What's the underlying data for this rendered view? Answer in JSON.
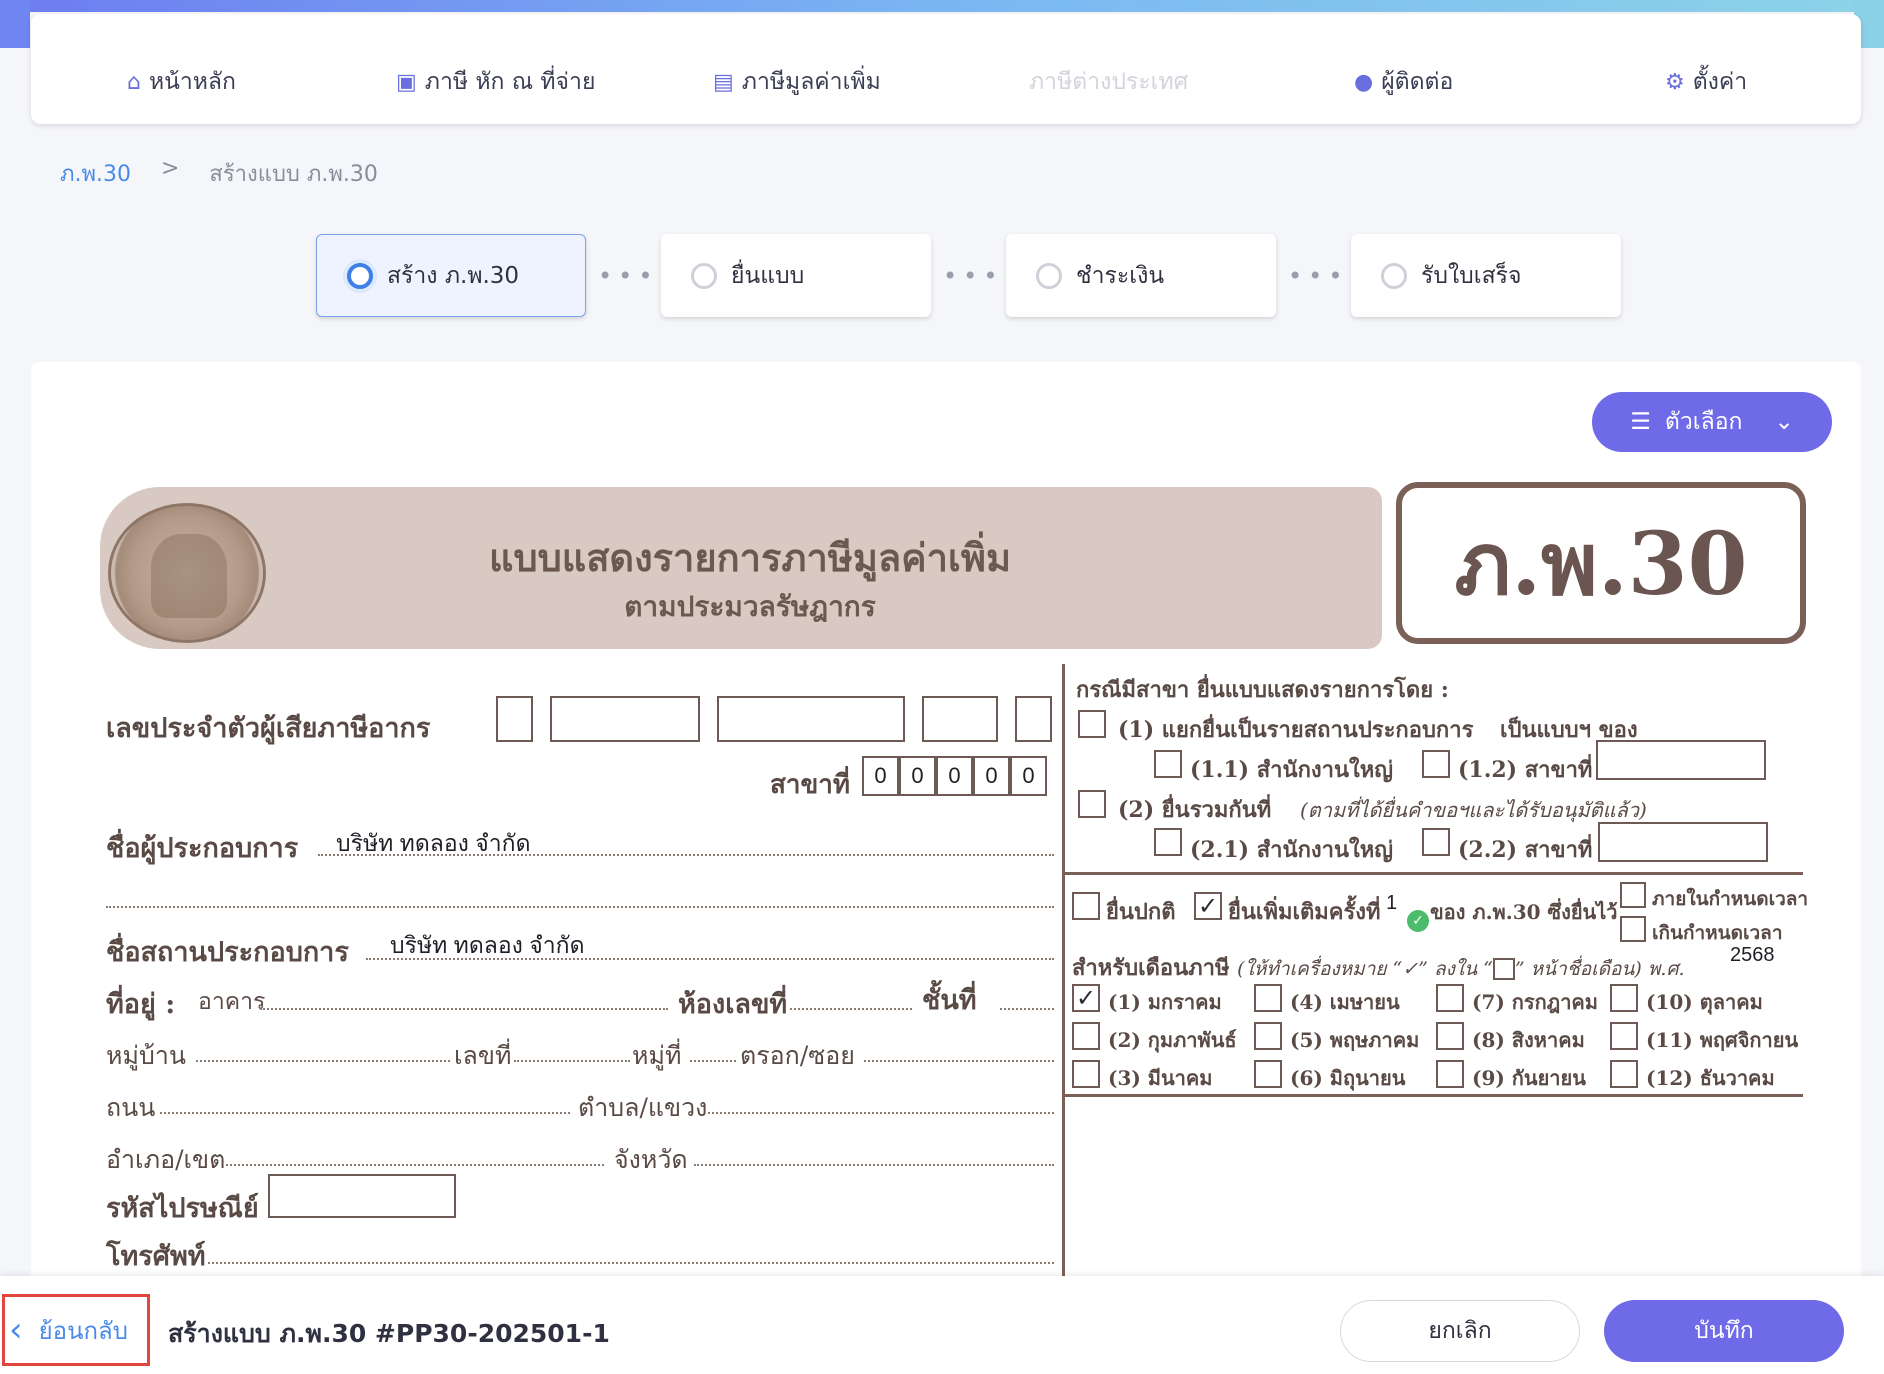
{
  "nav": {
    "items": [
      {
        "label": "หน้าหลัก",
        "icon": "home-icon",
        "glyph": "⌂"
      },
      {
        "label": "ภาษี หัก ณ ที่จ่าย",
        "icon": "wallet-icon",
        "glyph": "▣"
      },
      {
        "label": "ภาษีมูลค่าเพิ่ม",
        "icon": "document-icon",
        "glyph": "▤"
      },
      {
        "label": "ภาษีต่างประเทศ",
        "icon": "",
        "glyph": ""
      },
      {
        "label": "ผู้ติดต่อ",
        "icon": "user-icon",
        "glyph": "●"
      },
      {
        "label": "ตั้งค่า",
        "icon": "gear-icon",
        "glyph": "⚙"
      }
    ]
  },
  "breadcrumb": {
    "link": "ภ.พ.30",
    "separator": ">",
    "current": "สร้างแบบ ภ.พ.30"
  },
  "steps": [
    {
      "label": "สร้าง ภ.พ.30",
      "active": true
    },
    {
      "label": "ยื่นแบบ",
      "active": false
    },
    {
      "label": "ชำระเงิน",
      "active": false
    },
    {
      "label": "รับใบเสร็จ",
      "active": false
    }
  ],
  "options_button": {
    "label": "ตัวเลือก",
    "menu_glyph": "☰",
    "chevron": "⌄"
  },
  "form": {
    "title": "แบบแสดงรายการภาษีมูลค่าเพิ่ม",
    "subtitle": "ตามประมวลรัษฎากร",
    "code": "ภ.พ.30",
    "tax_id_label": "เลขประจำตัวผู้เสียภาษีอากร",
    "branch_label": "สาขาที่",
    "branch_digits": [
      "0",
      "0",
      "0",
      "0",
      "0"
    ],
    "operator_label": "ชื่อผู้ประกอบการ",
    "operator_name": "บริษัท ทดลอง จำกัด",
    "establishment_label": "ชื่อสถานประกอบการ",
    "establishment_name": "บริษัท ทดลอง จำกัด",
    "address_label": "ที่อยู่ :",
    "building_label": "อาคาร",
    "room_label": "ห้องเลขที่",
    "floor_label": "ชั้นที่",
    "village_label": "หมู่บ้าน",
    "house_no_label": "เลขที่",
    "moo_label": "หมู่ที่",
    "soi_label": "ตรอก/ซอย",
    "road_label": "ถนน",
    "subdistrict_label": "ตำบล/แขวง",
    "district_label": "อำเภอ/เขต",
    "province_label": "จังหวัด",
    "postcode_label": "รหัสไปรษณีย์",
    "phone_label": "โทรศัพท์",
    "branch_case_title": "กรณีมีสาขา ยื่นแบบแสดงรายการโดย :",
    "opt1": "(1) แยกยื่นเป็นรายสถานประกอบการ",
    "opt1_suffix": "เป็นแบบฯ ของ",
    "opt1_1": "(1.1) สำนักงานใหญ่",
    "opt1_2": "(1.2) สาขาที่",
    "opt2": "(2) ยื่นรวมกันที่",
    "opt2_note": "(ตามที่ได้ยื่นคำขอฯและได้รับอนุมัติแล้ว)",
    "opt2_1": "(2.1) สำนักงานใหญ่",
    "opt2_2": "(2.2) สาขาที่",
    "normal_filing": "ยื่นปกติ",
    "additional_filing": "ยื่นเพิ่มเติมครั้งที่",
    "additional_count": "1",
    "of_form": "ของ ภ.พ.30 ซึ่งยื่นไว้",
    "within_deadline": "ภายในกำหนดเวลา",
    "past_deadline": "เกินกำหนดเวลา",
    "month_instruction_a": "สำหรับเดือนภาษี",
    "month_instruction_b": "(ให้ทำเครื่องหมาย “✓” ลงใน “",
    "month_instruction_c": "” หน้าชื่อเดือน) พ.ศ.",
    "year": "2568",
    "check_glyph": "✓",
    "months": [
      {
        "label": "(1) มกราคม",
        "checked": true
      },
      {
        "label": "(2) กุมภาพันธ์",
        "checked": false
      },
      {
        "label": "(3) มีนาคม",
        "checked": false
      },
      {
        "label": "(4) เมษายน",
        "checked": false
      },
      {
        "label": "(5) พฤษภาคม",
        "checked": false
      },
      {
        "label": "(6) มิถุนายน",
        "checked": false
      },
      {
        "label": "(7) กรกฎาคม",
        "checked": false
      },
      {
        "label": "(8) สิงหาคม",
        "checked": false
      },
      {
        "label": "(9) กันยายน",
        "checked": false
      },
      {
        "label": "(10) ตุลาคม",
        "checked": false
      },
      {
        "label": "(11) พฤศจิกายน",
        "checked": false
      },
      {
        "label": "(12) ธันวาคม",
        "checked": false
      }
    ]
  },
  "footer": {
    "back_label": "ย้อนกลับ",
    "back_glyph": "‹",
    "title": "สร้างแบบ ภ.พ.30 #PP30-202501-1",
    "cancel_label": "ยกเลิก",
    "save_label": "บันทึก"
  },
  "colors": {
    "accent": "#6e6ae8",
    "link": "#4a8ae8",
    "form_brown": "#7a6057",
    "highlight": "#e2453b"
  }
}
